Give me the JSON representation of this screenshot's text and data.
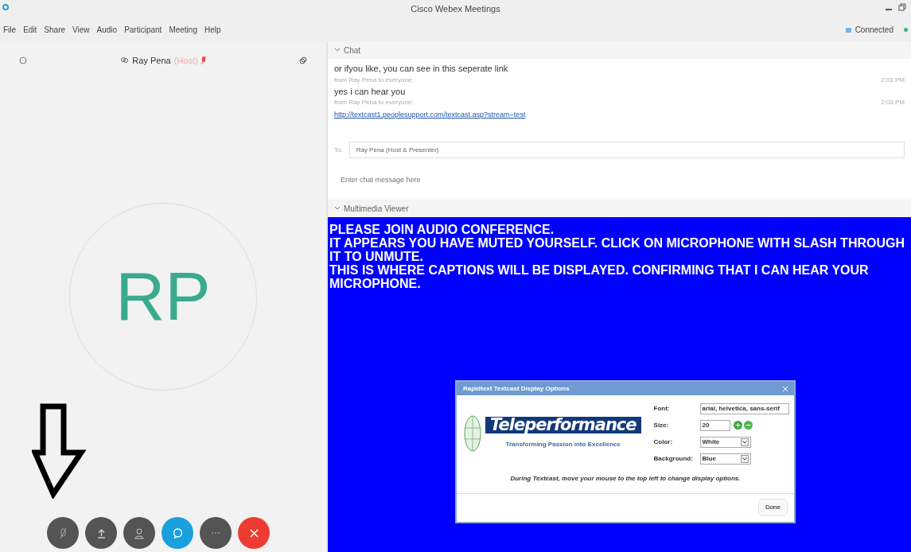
{
  "window": {
    "title": "Cisco Webex Meetings"
  },
  "menu": [
    "File",
    "Edit",
    "Share",
    "View",
    "Audio",
    "Participant",
    "Meeting",
    "Help"
  ],
  "connection": {
    "label": "Connected"
  },
  "stage": {
    "host_name": "Ray Pena",
    "host_role": "(Host)",
    "host_muted": true,
    "initials": "RP"
  },
  "controls": [
    {
      "kind": "mute"
    },
    {
      "kind": "share"
    },
    {
      "kind": "participants"
    },
    {
      "kind": "chat"
    },
    {
      "kind": "more"
    },
    {
      "kind": "leave"
    }
  ],
  "chat": {
    "title": "Chat",
    "messages": [
      {
        "kind": "text",
        "text": "or ifyou like, you can see in this seperate link",
        "meta": "from Ray Pena to everyone:",
        "time": "2:03 PM"
      },
      {
        "kind": "text",
        "text": "yes i can hear you",
        "meta": "from Ray Pena to everyone:",
        "time": "2:03 PM"
      },
      {
        "kind": "link",
        "text": "http://textcast1.peoplesupport.com/textcast.asp?stream=test"
      }
    ],
    "to_label": "To:",
    "to_value": "Ray Pena (Host & Presenter)",
    "placeholder": "Enter chat message here"
  },
  "viewer": {
    "title": "Multimedia Viewer",
    "captions": [
      "PLEASE JOIN AUDIO CONFERENCE.",
      "IT APPEARS YOU HAVE MUTED YOURSELF. CLICK ON MICROPHONE WITH SLASH THROUGH IT TO UNMUTE.",
      "THIS IS WHERE CAPTIONS WILL BE DISPLAYED. CONFIRMING THAT I CAN HEAR YOUR MICROPHONE."
    ],
    "dialog": {
      "title": "Rapidtext Textcast Display Options",
      "logo_text": "Teleperformance",
      "logo_tagline": "Transforming Passion into Excellence",
      "font_label": "Font:",
      "font_value": "arial, helvetica, sans-serif",
      "size_label": "Size:",
      "size_value": "20",
      "color_label": "Color:",
      "color_value": "White",
      "background_label": "Background:",
      "background_value": "Blue",
      "note": "During Textcast, move your mouse to the top left to change display options.",
      "done": "Done"
    }
  }
}
